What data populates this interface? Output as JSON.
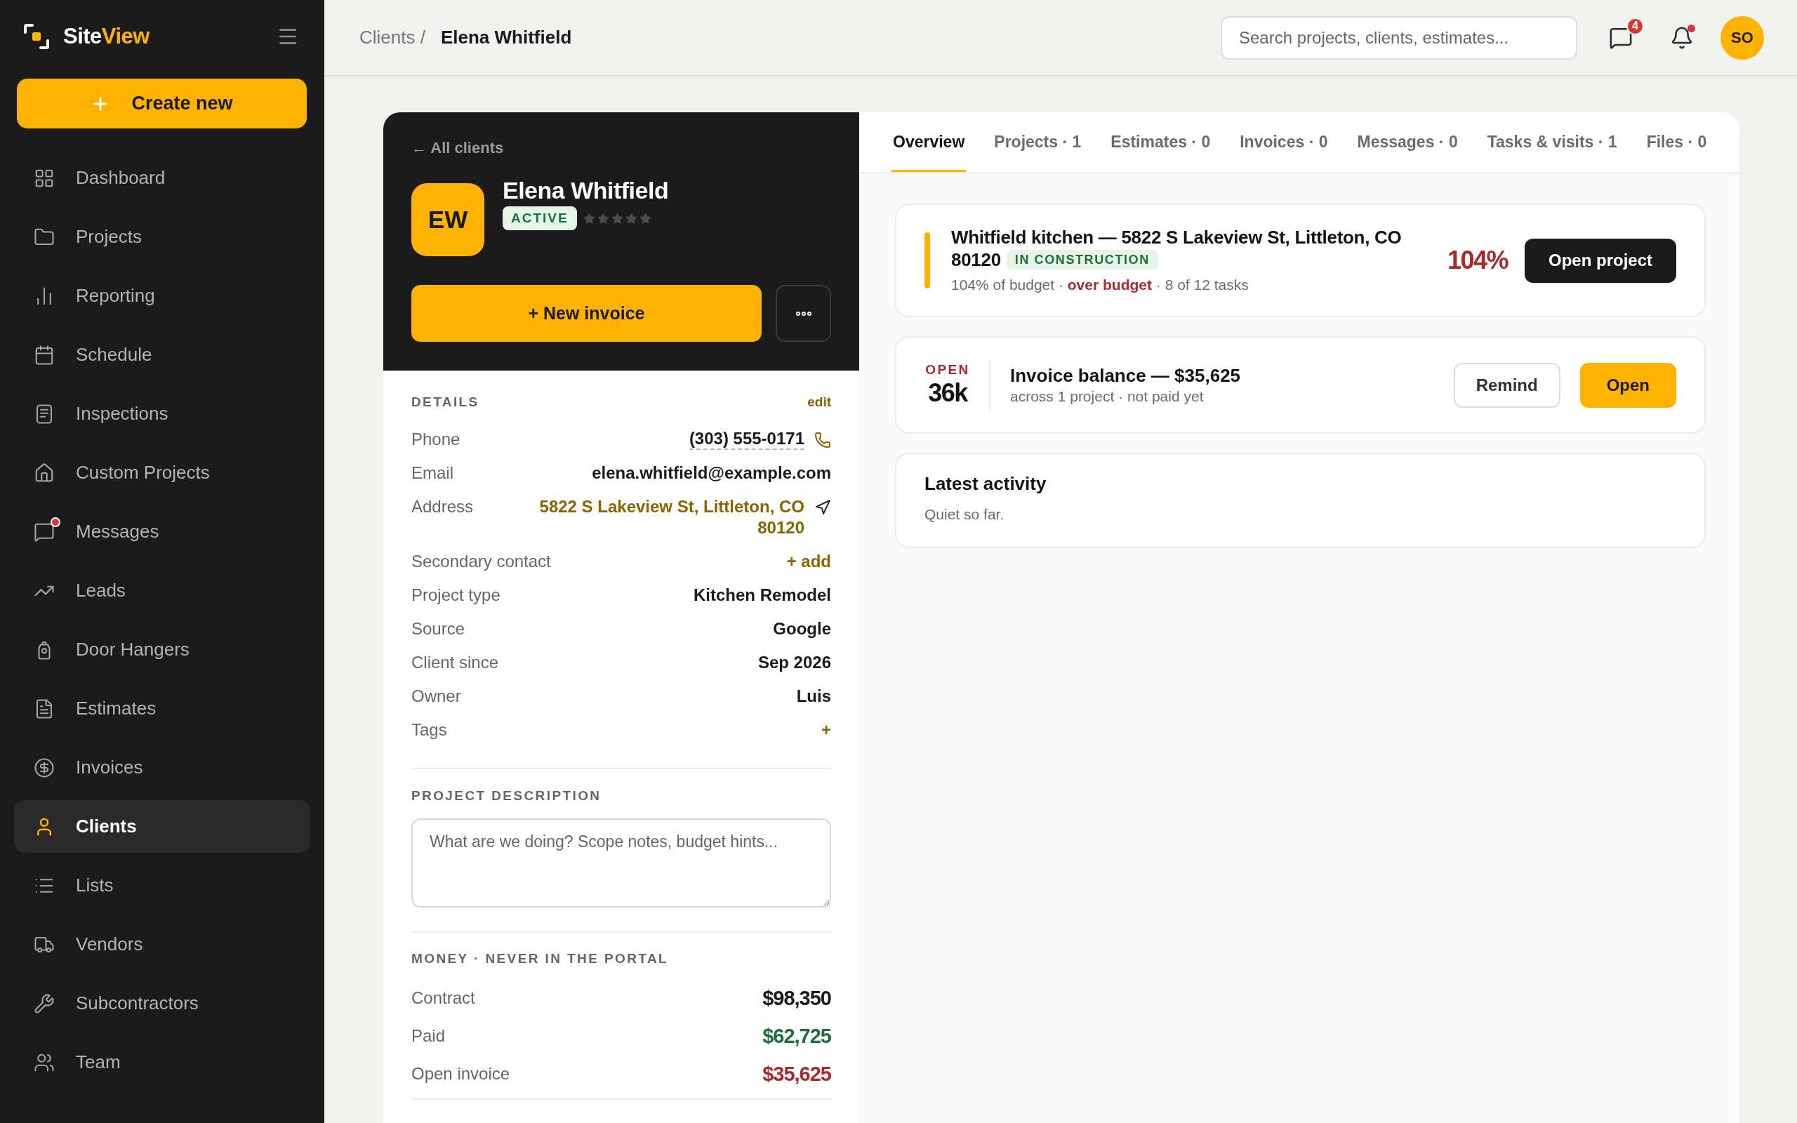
{
  "sidebar": {
    "brand": {
      "name": "Site",
      "accent": "View"
    },
    "create_button": "Create new",
    "items": [
      {
        "label": "Dashboard",
        "selected": false,
        "unread": false
      },
      {
        "label": "Projects",
        "selected": false,
        "unread": false
      },
      {
        "label": "Reporting",
        "selected": false,
        "unread": false
      },
      {
        "label": "Schedule",
        "selected": false,
        "unread": false
      },
      {
        "label": "Inspections",
        "selected": false,
        "unread": false
      },
      {
        "label": "Custom Projects",
        "selected": false,
        "unread": false
      },
      {
        "label": "Messages",
        "selected": false,
        "unread": true
      },
      {
        "label": "Leads",
        "selected": false,
        "unread": false
      },
      {
        "label": "Door Hangers",
        "selected": false,
        "unread": false
      },
      {
        "label": "Estimates",
        "selected": false,
        "unread": false
      },
      {
        "label": "Invoices",
        "selected": false,
        "unread": false
      },
      {
        "label": "Clients",
        "selected": true,
        "unread": false
      },
      {
        "label": "Lists",
        "selected": false,
        "unread": false
      },
      {
        "label": "Vendors",
        "selected": false,
        "unread": false
      },
      {
        "label": "Subcontractors",
        "selected": false,
        "unread": false
      },
      {
        "label": "Team",
        "selected": false,
        "unread": false
      }
    ]
  },
  "header": {
    "breadcrumb": {
      "parent": "Clients /",
      "current": "Elena Whitfield"
    },
    "search": {
      "placeholder": "Search projects, clients, estimates..."
    },
    "messages": {
      "count": "4"
    },
    "notifications": {
      "unread": true
    },
    "avatar": "SO"
  },
  "client": {
    "back_link": "← All clients",
    "initials": "EW",
    "name": "Elena Whitfield",
    "status": "ACTIVE",
    "stars": 0,
    "new_invoice": "+ New invoice"
  },
  "details": {
    "title": "DETAILS",
    "edit": "edit",
    "rows": [
      {
        "label": "Phone",
        "value": "(303) 555-0171",
        "kind": "phone"
      },
      {
        "label": "Email",
        "value": "elena.whitfield@example.com",
        "kind": "text"
      },
      {
        "label": "Address",
        "value": "5822 S Lakeview St, Littleton, CO 80120",
        "kind": "address"
      },
      {
        "label": "Secondary contact",
        "value": "+ add",
        "kind": "add"
      },
      {
        "label": "Project type",
        "value": "Kitchen Remodel",
        "kind": "text"
      },
      {
        "label": "Source",
        "value": "Google",
        "kind": "text"
      },
      {
        "label": "Client since",
        "value": "Sep 2026",
        "kind": "text"
      },
      {
        "label": "Owner",
        "value": "Luis",
        "kind": "text"
      },
      {
        "label": "Tags",
        "value": "+",
        "kind": "add"
      }
    ]
  },
  "project_description": {
    "title": "PROJECT DESCRIPTION",
    "placeholder": "What are we doing? Scope notes, budget hints..."
  },
  "money": {
    "title": "MONEY · NEVER IN THE PORTAL",
    "rows": [
      {
        "label": "Contract",
        "value": "$98,350",
        "color": "#1a1a1a"
      },
      {
        "label": "Paid",
        "value": "$62,725",
        "color": "#1e6e3a"
      },
      {
        "label": "Open invoice",
        "value": "$35,625",
        "color": "#a82a2a"
      }
    ]
  },
  "tabs": [
    {
      "label": "Overview",
      "selected": true
    },
    {
      "label": "Projects · 1",
      "selected": false
    },
    {
      "label": "Estimates · 0",
      "selected": false
    },
    {
      "label": "Invoices · 0",
      "selected": false
    },
    {
      "label": "Messages · 0",
      "selected": false
    },
    {
      "label": "Tasks & visits · 1",
      "selected": false
    },
    {
      "label": "Files · 0",
      "selected": false
    }
  ],
  "project_card": {
    "title_lines": [
      "Whitfield kitchen — 5822 S Lakeview St, Littleton, CO",
      "80120"
    ],
    "status": "IN CONSTRUCTION",
    "summary": "104% of budget · **over budget** · 8 of 12 tasks",
    "percent": "104%",
    "button": "Open project"
  },
  "invoice_card": {
    "label": "OPEN",
    "amount": "36k",
    "title": "Invoice balance — $35,625",
    "subtitle": "across 1 project · not paid yet",
    "buttons": [
      {
        "label": "Remind",
        "kind": "secondary"
      },
      {
        "label": "Open",
        "kind": "primary"
      }
    ]
  },
  "activity": {
    "title": "Latest activity",
    "text": "Quiet so far."
  }
}
